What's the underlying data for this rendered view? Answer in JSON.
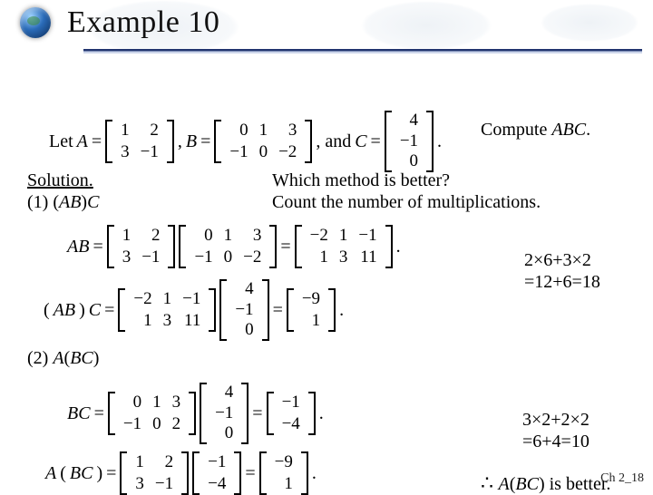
{
  "header": {
    "title": "Example 10"
  },
  "problem": {
    "let_label": "Let ",
    "A_label": "A",
    "A": [
      [
        "1",
        "2"
      ],
      [
        "3",
        "−1"
      ]
    ],
    "B_label": "B",
    "B": [
      [
        "0",
        "1",
        "3"
      ],
      [
        "−1",
        "0",
        "−2"
      ]
    ],
    "C_label": "C",
    "C": [
      [
        "4"
      ],
      [
        "−1"
      ],
      [
        "0"
      ]
    ],
    "and_label": ", and ",
    "compute_label": "Compute ",
    "compute_target": "ABC",
    "period": "."
  },
  "solution_heading": "Solution.",
  "part1_label": "(1) (",
  "part1_AB": "AB",
  "part1_close": ")",
  "part1_C": "C",
  "question1": "Which method is better?",
  "question2": "Count the number of multiplications.",
  "AB_lhs": "AB",
  "A_rep": [
    [
      "1",
      "2"
    ],
    [
      "3",
      "−1"
    ]
  ],
  "B_rep": [
    [
      "0",
      "1",
      "3"
    ],
    [
      "−1",
      "0",
      "−2"
    ]
  ],
  "AB_result": [
    [
      "−2",
      "1",
      "−1"
    ],
    [
      "1",
      "3",
      "11"
    ]
  ],
  "ABC_lhs_open": "(",
  "ABC_lhs_AB": "AB",
  "ABC_lhs_close": ")",
  "ABC_lhs_C": "C",
  "AB_rep": [
    [
      "−2",
      "1",
      "−1"
    ],
    [
      "1",
      "3",
      "11"
    ]
  ],
  "C_rep": [
    [
      "4"
    ],
    [
      "−1"
    ],
    [
      "0"
    ]
  ],
  "ABC_result": [
    [
      "−9"
    ],
    [
      "1"
    ]
  ],
  "cost1_line1": "2×6+3×2",
  "cost1_line2": "=12+6=18",
  "part2_label_open": "(2) ",
  "part2_A": "A",
  "part2_paren_open": "(",
  "part2_BC": "BC",
  "part2_paren_close": ")",
  "BC_lhs": "BC",
  "B_rep2": [
    [
      "0",
      "1",
      "3"
    ],
    [
      "−1",
      "0",
      "2"
    ]
  ],
  "C_rep2": [
    [
      "4"
    ],
    [
      "−1"
    ],
    [
      "0"
    ]
  ],
  "BC_result": [
    [
      "−1"
    ],
    [
      "−4"
    ]
  ],
  "ABC2_lhs_A": "A",
  "ABC2_lhs_open": "(",
  "ABC2_lhs_BC": "BC",
  "ABC2_lhs_close": ")",
  "A_rep2": [
    [
      "1",
      "2"
    ],
    [
      "3",
      "−1"
    ]
  ],
  "BC_rep": [
    [
      "−1"
    ],
    [
      "−4"
    ]
  ],
  "ABC2_result": [
    [
      "−9"
    ],
    [
      "1"
    ]
  ],
  "cost2_line1": "3×2+2×2",
  "cost2_line2": "=6+4=10",
  "conclusion_prefix": "∴ ",
  "conclusion_A": "A",
  "conclusion_open": "(",
  "conclusion_BC": "BC",
  "conclusion_close": ")",
  "conclusion_rest": " is better.",
  "footer": "Ch 2_18",
  "eq_sign": " = ",
  "comma": ", "
}
